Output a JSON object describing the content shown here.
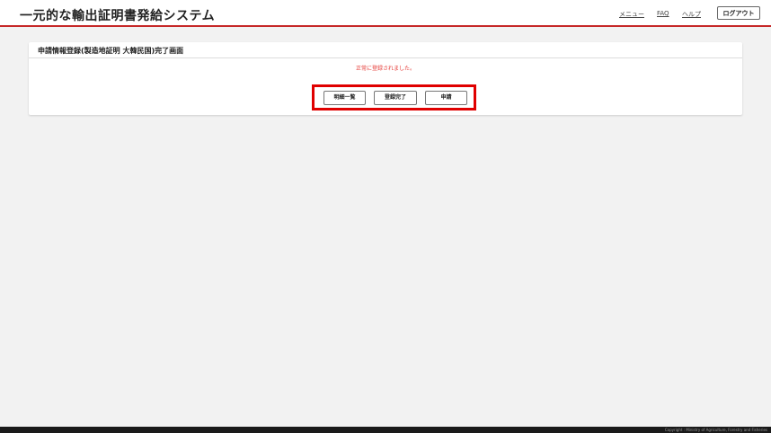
{
  "header": {
    "title": "一元的な輸出証明書発給システム",
    "nav": {
      "menu": "メニュー",
      "faq": "FAQ",
      "help": "ヘルプ"
    },
    "logout_label": "ログアウト"
  },
  "panel": {
    "title": "申請情報登録(製造地証明 大韓民国)完了画面",
    "message": "正常に登録されました。",
    "buttons": {
      "detail_list": "明細一覧",
      "registration_complete": "登録完了",
      "apply": "申請"
    }
  },
  "footer": {
    "copyright": "Copyright : Ministry of Agriculture, Forestry and Fisheries"
  },
  "colors": {
    "accent_red": "#c62828",
    "highlight_red": "#e00000",
    "message_red": "#e53935",
    "footer_bg": "#1a1a1a"
  }
}
